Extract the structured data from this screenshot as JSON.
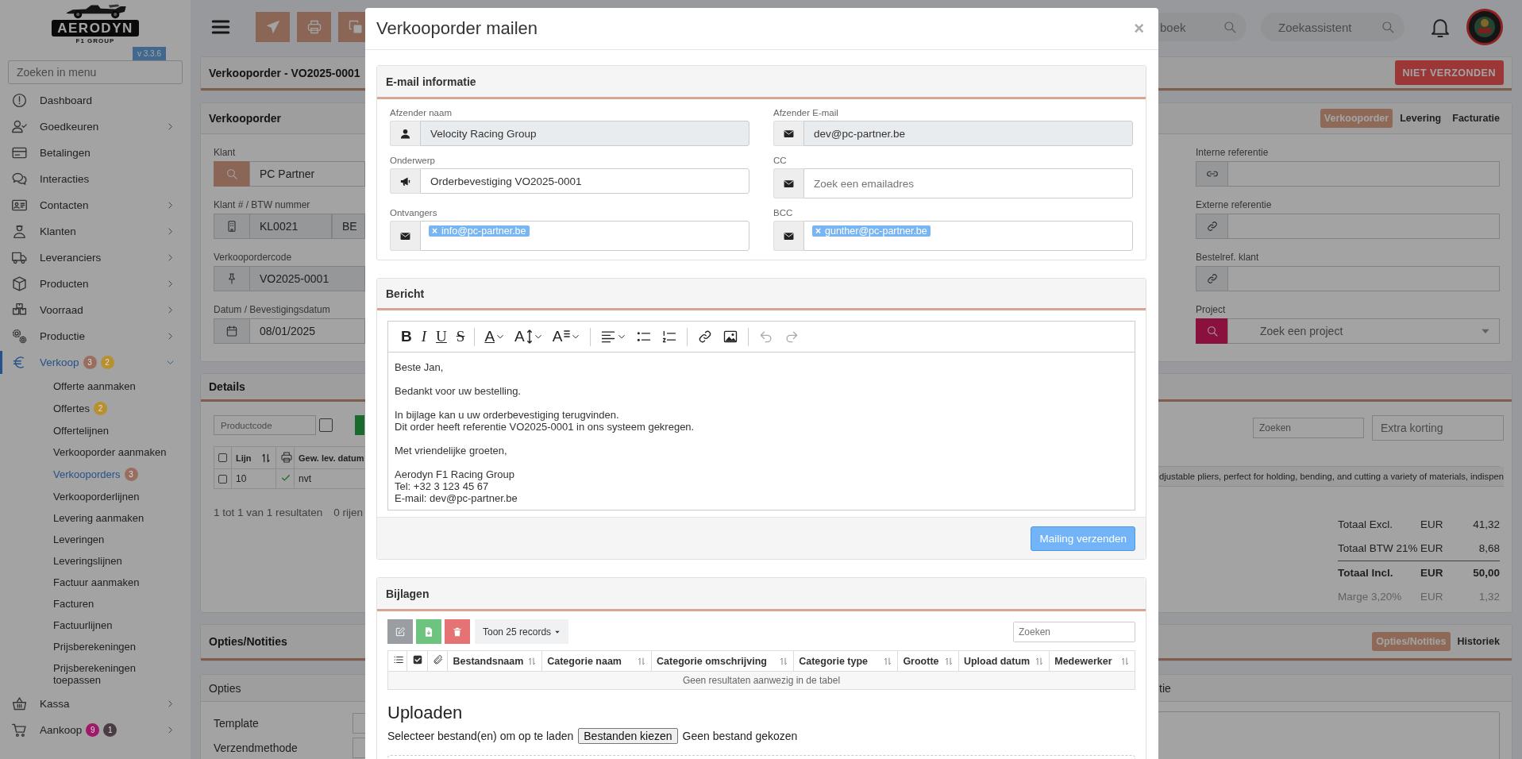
{
  "sidebar": {
    "logo": {
      "name": "AERODYN",
      "subtitle": "F1 GROUP"
    },
    "version": "v 3.3.6",
    "search": {
      "placeholder": "Zoeken in menu"
    },
    "items": [
      {
        "label": "Dashboard",
        "selected": false
      },
      {
        "label": "Goedkeuren",
        "selected": false,
        "expanded": false
      },
      {
        "label": "Betalingen",
        "selected": false
      },
      {
        "label": "Interacties",
        "selected": false
      },
      {
        "label": "Contacten",
        "selected": false,
        "expanded": false
      },
      {
        "label": "Klanten",
        "selected": false,
        "expanded": false
      },
      {
        "label": "Leveranciers",
        "selected": false,
        "expanded": false
      },
      {
        "label": "Producten",
        "selected": false,
        "expanded": false
      },
      {
        "label": "Voorraad",
        "selected": false,
        "expanded": false
      },
      {
        "label": "Productie",
        "selected": false,
        "expanded": false
      },
      {
        "label": "Verkoop",
        "selected": true,
        "expanded": true,
        "badges": [
          {
            "text": "3",
            "color": "#9a6e5e"
          },
          {
            "text": "2",
            "color": "#b8902f"
          }
        ],
        "children": [
          {
            "label": "Offerte aanmaken",
            "selected": false
          },
          {
            "label": "Offertes",
            "selected": false,
            "badges": [
              {
                "text": "2",
                "color": "#b8902f"
              }
            ]
          },
          {
            "label": "Offertelijnen",
            "selected": false
          },
          {
            "label": "Verkooporder aanmaken",
            "selected": false
          },
          {
            "label": "Verkooporders",
            "selected": true,
            "badges": [
              {
                "text": "3",
                "color": "#9a6e5e"
              }
            ]
          },
          {
            "label": "Verkooporderlijnen",
            "selected": false
          },
          {
            "label": "Levering aanmaken",
            "selected": false
          },
          {
            "label": "Leveringen",
            "selected": false
          },
          {
            "label": "Leveringslijnen",
            "selected": false
          },
          {
            "label": "Factuur aanmaken",
            "selected": false
          },
          {
            "label": "Facturen",
            "selected": false
          },
          {
            "label": "Factuurlijnen",
            "selected": false
          },
          {
            "label": "Prijsberekeningen",
            "selected": false
          },
          {
            "label": "Prijsberekeningen toepassen",
            "selected": false
          }
        ]
      },
      {
        "label": "Kassa",
        "selected": false,
        "expanded": false
      },
      {
        "label": "Aankoop",
        "selected": false,
        "expanded": false,
        "badges": [
          {
            "text": "9",
            "color": "#a0186a"
          },
          {
            "text": "1",
            "color": "#4a3c44"
          }
        ]
      }
    ]
  },
  "topbar": {
    "searches": [
      {
        "placeholder": "boek"
      },
      {
        "placeholder": "Zoekassistent"
      }
    ]
  },
  "order": {
    "title": "Verkooporder - VO2025-0001",
    "status": "NIET VERZONDEN"
  },
  "order_card": {
    "title": "Verkooporder",
    "tabs": [
      {
        "label": "Verkooporder",
        "selected": true
      },
      {
        "label": "Levering",
        "selected": false
      },
      {
        "label": "Facturatie",
        "selected": false
      }
    ],
    "left_fields": [
      {
        "label": "Klant",
        "values": [
          "PC Partner"
        ],
        "readonly": false
      },
      {
        "label": "Klant # / BTW nummer",
        "values": [
          "KL0021",
          "BE"
        ],
        "readonly": true
      },
      {
        "label": "Verkoopordercode",
        "values": [
          "VO2025-0001"
        ],
        "readonly": true
      },
      {
        "label": "Datum / Bevestigingsdatum",
        "values": [
          "08/01/2025"
        ],
        "readonly": false
      }
    ],
    "right_fields": [
      {
        "label": "Interne referentie"
      },
      {
        "label": "Externe referentie"
      },
      {
        "label": "Bestelref. klant"
      },
      {
        "label": "Project",
        "placeholder": "Zoek een project"
      }
    ]
  },
  "details": {
    "title": "Details",
    "productcode_placeholder": "Productcode",
    "search_placeholder": "Zoeken",
    "discount_placeholder": "Extra korting",
    "product_toggle": false,
    "select_all": false,
    "columns": [
      {
        "label": "Lijn",
        "sortable": true
      },
      {
        "label": "Gew. lev. datum"
      }
    ],
    "rows": [
      {
        "selected": false,
        "line": "10",
        "printed": true,
        "delivery_date": "nvt",
        "description": "djustable pliers, perfect for holding, bending, and cutting a variety of materials, indispen"
      }
    ],
    "summary": "1 tot 1 van 1 resultaten",
    "selection": "0 rijen",
    "totals": [
      {
        "label": "Totaal Excl.",
        "currency": "EUR",
        "amount": "41,32",
        "kind": "normal"
      },
      {
        "label": "Totaal BTW 21%",
        "currency": "EUR",
        "amount": "8,68",
        "kind": "normal"
      },
      {
        "label": "Totaal Incl.",
        "currency": "EUR",
        "amount": "50,00",
        "kind": "total"
      },
      {
        "label": "Marge 3,20%",
        "currency": "EUR",
        "amount": "1,32",
        "kind": "muted"
      }
    ]
  },
  "notes": {
    "title": "Opties/Notities",
    "tabs": [
      {
        "label": "Opties/Notities",
        "selected": true
      },
      {
        "label": "Historiek",
        "selected": false
      }
    ],
    "options": {
      "title": "Opties",
      "fields": [
        "Template",
        "Verzendmethode"
      ]
    },
    "side_panel": {
      "title": "tie"
    }
  },
  "modal": {
    "title": "Verkooporder mailen",
    "close": "×",
    "email_info": {
      "title": "E-mail informatie",
      "fields": [
        {
          "label": "Afzender naam",
          "value": "Velocity Racing Group",
          "readonly": true
        },
        {
          "label": "Afzender E-mail",
          "value": "dev@pc-partner.be",
          "readonly": true
        },
        {
          "label": "Onderwerp",
          "value": "Orderbevestiging VO2025-0001",
          "readonly": false
        },
        {
          "label": "CC",
          "placeholder": "Zoek een emailadres",
          "readonly": false
        },
        {
          "label": "Ontvangers",
          "tags": [
            {
              "remove": "×",
              "text": "info@pc-partner.be"
            }
          ],
          "readonly": false
        },
        {
          "label": "BCC",
          "tags": [
            {
              "remove": "×",
              "text": "gunther@pc-partner.be"
            }
          ],
          "readonly": false
        }
      ]
    },
    "message": {
      "title": "Bericht",
      "toolbar": [
        [
          {
            "kind": "bold",
            "label": "B"
          },
          {
            "kind": "italic",
            "label": "I"
          },
          {
            "kind": "underline",
            "label": "U"
          },
          {
            "kind": "strike",
            "label": "S"
          }
        ],
        [
          {
            "kind": "font-color",
            "label": "A",
            "dropdown": true
          },
          {
            "kind": "font-size",
            "label": "A",
            "dropdown": true
          },
          {
            "kind": "font-style",
            "label": "A",
            "dropdown": true
          }
        ],
        [
          {
            "kind": "align",
            "dropdown": true
          },
          {
            "kind": "bullet-list"
          },
          {
            "kind": "numbered-list"
          }
        ],
        [
          {
            "kind": "link"
          },
          {
            "kind": "image"
          }
        ],
        [
          {
            "kind": "undo",
            "disabled": true
          },
          {
            "kind": "redo",
            "disabled": true
          }
        ]
      ],
      "body": [
        [
          "Beste Jan,"
        ],
        [
          "Bedankt voor uw bestelling."
        ],
        [
          "In bijlage kan u uw orderbevestiging terugvinden.",
          "Dit order heeft referentie VO2025-0001 in ons systeem gekregen."
        ],
        [
          "Met vriendelijke groeten,"
        ],
        [
          "Aerodyn F1 Racing Group",
          "Tel: +32 3 123 45 67",
          "E-mail: dev@pc-partner.be"
        ]
      ],
      "send_button": "Mailing verzenden"
    },
    "attachments": {
      "title": "Bijlagen",
      "page_size": "Toon 25 records",
      "search_placeholder": "Zoeken",
      "columns": [
        {
          "label": "Bestandsnaam"
        },
        {
          "label": "Categorie naam"
        },
        {
          "label": "Categorie omschrijving"
        },
        {
          "label": "Categorie type"
        },
        {
          "label": "Grootte"
        },
        {
          "label": "Upload datum"
        },
        {
          "label": "Medewerker"
        }
      ],
      "empty": "Geen resultaten aanwezig in de tabel"
    },
    "upload": {
      "title": "Uploaden",
      "prompt": "Selecteer bestand(en) om op te laden",
      "button": "Bestanden kiezen",
      "status": "Geen bestand gekozen"
    }
  }
}
